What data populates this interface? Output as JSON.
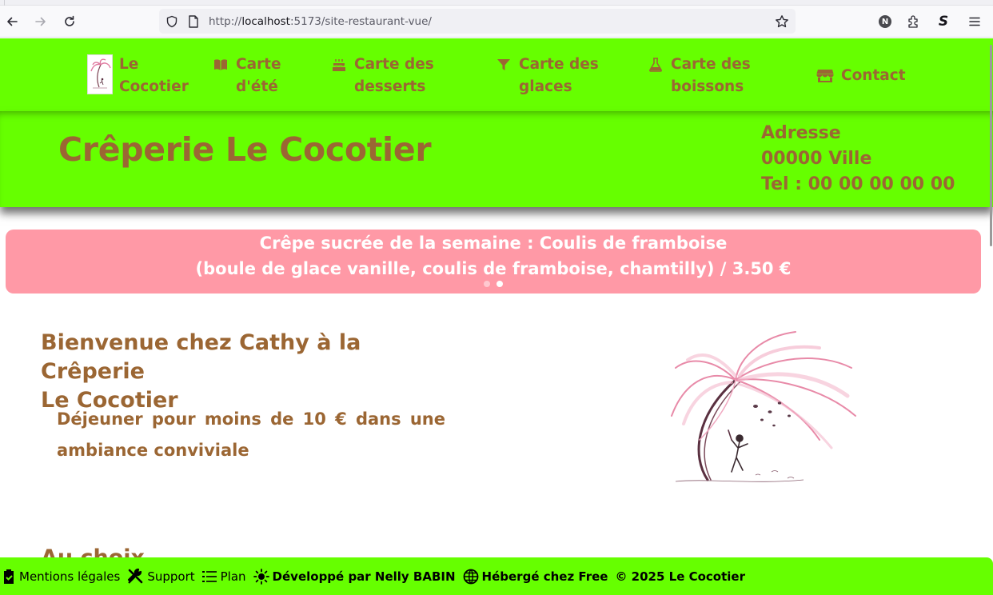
{
  "browser": {
    "url_prefix": "http://",
    "url_host": "localhost",
    "url_path": ":5173/site-restaurant-vue/",
    "extension_badge_n": "N",
    "extension_badge_s": "S"
  },
  "nav": {
    "logo_line1": "Le",
    "logo_line2": "Cocotier",
    "items": [
      {
        "line1": "Carte",
        "line2": "d'été",
        "icon": "book-icon"
      },
      {
        "line1": "Carte des",
        "line2": "desserts",
        "icon": "cake-icon"
      },
      {
        "line1": "Carte des",
        "line2": "glaces",
        "icon": "funnel-icon"
      },
      {
        "line1": "Carte des",
        "line2": "boissons",
        "icon": "flask-icon"
      },
      {
        "line1": "Contact",
        "line2": "",
        "icon": "store-icon"
      }
    ]
  },
  "header": {
    "title": "Crêperie Le Cocotier",
    "address_line1": "Adresse",
    "address_line2": "00000 Ville",
    "phone": "Tel : 00 00 00 00 00"
  },
  "carousel": {
    "line1": "Crêpe sucrée de la semaine : Coulis de framboise",
    "line2": "(boule de glace vanille, coulis de framboise, chamtilly) / 3.50 €",
    "slide_count": 2,
    "active_slide": 2
  },
  "main": {
    "welcome_line1": "Bienvenue chez Cathy à la Crêperie",
    "welcome_line2": "Le Cocotier",
    "tagline": "Déjeuner pour moins de 10 € dans une ambiance conviviale",
    "next_heading": "Au choix"
  },
  "footer": {
    "legal": "Mentions légales",
    "support": "Support",
    "plan": "Plan",
    "developer": "Développé par Nelly BABIN",
    "hosting": "Hébergé chez Free",
    "copyright": "© 2025 Le Cocotier"
  },
  "colors": {
    "brand_green": "#66ff00",
    "text_brown": "#9b6633",
    "carousel_pink": "#ff99a6"
  }
}
